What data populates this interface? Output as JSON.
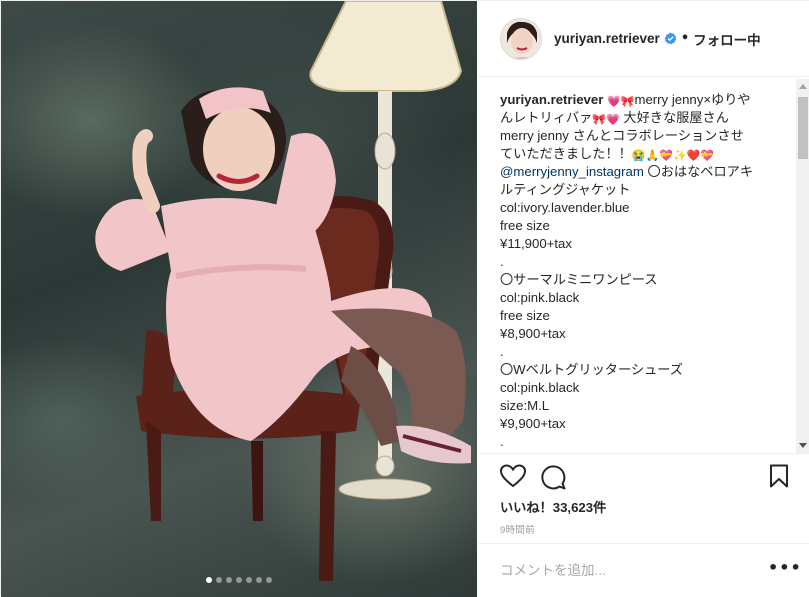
{
  "post": {
    "username": "yuriyan.retriever",
    "follow_separator": "•",
    "follow_label": "フォロー中",
    "caption": {
      "lines": [
        {
          "segments": [
            {
              "t": "yuriyan.retriever",
              "k": "user"
            },
            {
              "t": " ",
              "k": "text"
            },
            {
              "t": "💗🎀",
              "k": "emoji"
            },
            {
              "t": "merry jenny×ゆりや",
              "k": "text"
            }
          ]
        },
        {
          "segments": [
            {
              "t": "んレトリィバァ",
              "k": "text"
            },
            {
              "t": "🎀💗",
              "k": "emoji"
            },
            {
              "t": " 大好きな服屋さん",
              "k": "text"
            }
          ]
        },
        {
          "segments": [
            {
              "t": "merry jenny さんとコラボレーションさせ",
              "k": "text"
            }
          ]
        },
        {
          "segments": [
            {
              "t": "ていただきました！！",
              "k": "text"
            },
            {
              "t": "😭🙏💝✨❤️💝",
              "k": "emoji"
            }
          ]
        },
        {
          "segments": [
            {
              "t": "@merryjenny_instagram",
              "k": "mention"
            },
            {
              "t": " 〇おはなベロアキ",
              "k": "text"
            }
          ]
        },
        {
          "segments": [
            {
              "t": "ルティングジャケット",
              "k": "text"
            }
          ]
        },
        {
          "segments": [
            {
              "t": "col:ivory.lavender.blue",
              "k": "text"
            }
          ]
        },
        {
          "segments": [
            {
              "t": "free size",
              "k": "text"
            }
          ]
        },
        {
          "segments": [
            {
              "t": "¥11,900+tax",
              "k": "text"
            }
          ]
        },
        {
          "segments": [
            {
              "t": ".",
              "k": "text"
            }
          ]
        },
        {
          "segments": [
            {
              "t": "〇サーマルミニワンピース",
              "k": "text"
            }
          ]
        },
        {
          "segments": [
            {
              "t": "col:pink.black",
              "k": "text"
            }
          ]
        },
        {
          "segments": [
            {
              "t": "free size",
              "k": "text"
            }
          ]
        },
        {
          "segments": [
            {
              "t": "¥8,900+tax",
              "k": "text"
            }
          ]
        },
        {
          "segments": [
            {
              "t": ".",
              "k": "text"
            }
          ]
        },
        {
          "segments": [
            {
              "t": "〇Wベルトグリッターシューズ",
              "k": "text"
            }
          ]
        },
        {
          "segments": [
            {
              "t": "col:pink.black",
              "k": "text"
            }
          ]
        },
        {
          "segments": [
            {
              "t": "size:M.L",
              "k": "text"
            }
          ]
        },
        {
          "segments": [
            {
              "t": "¥9,900+tax",
              "k": "text"
            }
          ]
        },
        {
          "segments": [
            {
              "t": ".",
              "k": "text"
            }
          ]
        }
      ]
    },
    "likes_label": "いいね！33,623件",
    "time_ago": "9時間前",
    "comment_placeholder": "コメントを追加...",
    "more_label": "•••",
    "carousel": {
      "count": 7,
      "active_index": 0
    }
  },
  "icons": {
    "verified": "verified-badge-icon",
    "like": "heart-icon",
    "comment": "comment-bubble-icon",
    "save": "bookmark-icon"
  },
  "colors": {
    "verified_blue": "#3897f0",
    "mention": "#003569",
    "text": "#262626",
    "muted": "#999999",
    "dress_pink": "#f2c6c9",
    "chair_wood": "#5a2218"
  }
}
